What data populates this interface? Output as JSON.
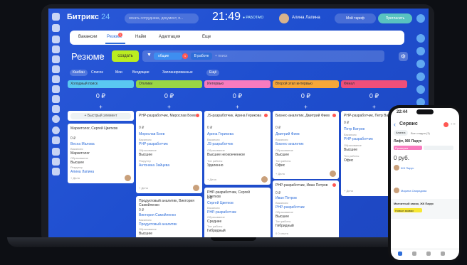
{
  "app": {
    "logo": "Битрикс",
    "logo_num": "24",
    "search_placeholder": "искать сотрудника, документ, п...",
    "clock": "21:49",
    "work_status": "● РАБОТАЮ",
    "user_name": "Алина Лапина",
    "tariff_label": "Мой тариф",
    "invite_label": "Пригласить"
  },
  "tabs": [
    {
      "label": "Вакансии"
    },
    {
      "label": "Резюме",
      "badge": "1"
    },
    {
      "label": "Найм"
    },
    {
      "label": "Адаптация"
    },
    {
      "label": "Еще"
    }
  ],
  "page": {
    "title": "Резюме",
    "create_label": "создать",
    "filter_chip": "общие",
    "filter_chip_count": "1",
    "filter_chip2": "В работе",
    "filter_search": "+ поиск"
  },
  "viewbar": [
    "Канбан",
    "Список",
    "Мои",
    "Входящие",
    "Запланированные",
    "Ещё"
  ],
  "columns": [
    {
      "title": "Холодный поиск",
      "color": "#5ac8f1",
      "sum": "0 ₽"
    },
    {
      "title": "Отклики",
      "color": "#9ad645",
      "sum": "0 ₽"
    },
    {
      "title": "Интервью",
      "color": "#f87bbf",
      "sum": "0 ₽"
    },
    {
      "title": "Второй этап интервью",
      "color": "#f7a738",
      "sum": "0 ₽"
    },
    {
      "title": "Финал",
      "color": "#ef4f7a",
      "sum": "0 ₽"
    }
  ],
  "quick_add": "+ Быстрый элемент",
  "cards": [
    {
      "title": "Маркетолог, Сергей Цветков",
      "value": "0 ₽",
      "name": "Весна Малова",
      "lbl1": "Вакансия",
      "val1": "Маркетолог",
      "lbl2": "Образование",
      "val2": "Высшее",
      "lbl3": "Рекрутер",
      "val3": "Алина Лапина",
      "footer": "+ Дела"
    },
    {
      "title": "PHP-разработчик, Мирослав Боев",
      "value": "0 ₽",
      "name": "Мирослав Боев",
      "lbl1": "Вакансия",
      "val1": "PHP-разработчик",
      "lbl2": "Образование",
      "val2": "Высшее",
      "lbl3": "Рекрутер",
      "val3": "Антонина Зайцева",
      "footer": "+ Дела"
    },
    {
      "title": "Продуктовый аналитик, Виктория Самойленко",
      "value": "0 ₽",
      "name": "Виктория Самойленко",
      "lbl1": "Вакансия",
      "val1": "Продуктовый аналитик",
      "lbl2": "Образование",
      "val2": "Высшее",
      "lbl3": "",
      "val3": "",
      "footer": ""
    },
    {
      "title": "JS-разработчик, Арина Герикова",
      "value": "0 ₽",
      "name": "Арина Герикова",
      "lbl1": "Вакансия",
      "val1": "JS-разработчик",
      "lbl2": "Образование",
      "val2": "Высшее неоконченное",
      "lbl3": "Тип работы",
      "val3": "Удаленно",
      "footer": "+ Дела"
    },
    {
      "title": "PHP-разработчик, Сергей Цветков",
      "value": "0 ₽",
      "name": "Сергей Цветков",
      "lbl1": "Вакансия",
      "val1": "PHP-разработчик",
      "lbl2": "Образование",
      "val2": "Среднее",
      "lbl3": "Тип работы",
      "val3": "Гибридный",
      "footer": ""
    },
    {
      "title": "Бизнес-аналитик, Дмитрий Фиев",
      "value": "0 ₽",
      "name": "Дмитрий Фиев",
      "lbl1": "Вакансия",
      "val1": "Бизнес-аналитик",
      "lbl2": "Образование",
      "val2": "Высшее",
      "lbl3": "Тип работы",
      "val3": "Офис",
      "footer": "+ Дела"
    },
    {
      "title": "PHP-разработчик, Иван Петров",
      "value": "0 ₽",
      "name": "Иван Петров",
      "lbl1": "Вакансия",
      "val1": "PHP-разработчик",
      "lbl2": "Образование",
      "val2": "Высшее",
      "lbl3": "Тип работы",
      "val3": "Гибридный",
      "footer": "0 0 опыта"
    },
    {
      "title": "PHP-разработчик, Петр Ватров",
      "value": "0 ₽",
      "name": "Петр Ватров",
      "lbl1": "Вакансия",
      "val1": "PHP-разработчик",
      "lbl2": "Образование",
      "val2": "Высшее",
      "lbl3": "Тип работы",
      "val3": "Офис",
      "footer": "+ Дела"
    }
  ],
  "phone": {
    "time": "22:44",
    "title": "Сервис",
    "tab1": "Анализ",
    "tab2": "Все стадии (3)",
    "deal_title": "Лифт, ЖК Парус",
    "stage": "Проверка",
    "amount": "0 руб.",
    "company": "ЖК Парус",
    "manager": "Марина Свиридова",
    "deal2_title": "Магнитный замок, ЖК Парус",
    "deal2_stage": "Новые заявки"
  }
}
